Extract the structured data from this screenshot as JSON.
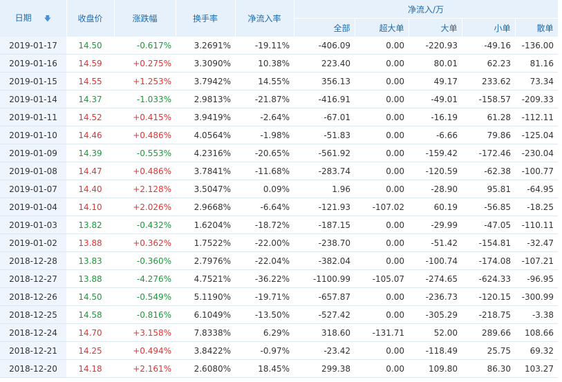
{
  "headers": {
    "date": "日期",
    "close": "收盘价",
    "change": "涨跌幅",
    "turnover": "换手率",
    "net_rate": "净流入率",
    "net_flow_group": "净流入/万",
    "all": "全部",
    "super": "超大单",
    "large": "大单",
    "small": "小单",
    "retail": "散单",
    "sort_icon": "sort-down-arrow-icon"
  },
  "colors": {
    "up": "#e53333",
    "down": "#1a9a3a",
    "header_bg": "#e7f1fb",
    "header_text": "#1c6bb0"
  },
  "rows": [
    {
      "date": "2019-01-17",
      "close": "14.50",
      "change": "-0.617%",
      "turnover": "3.2691%",
      "rate": "-19.11%",
      "all": "-406.09",
      "super": "0.00",
      "large": "-220.93",
      "small": "-49.16",
      "retail": "-136.00",
      "trend": "down"
    },
    {
      "date": "2019-01-16",
      "close": "14.59",
      "change": "+0.275%",
      "turnover": "3.3090%",
      "rate": "10.38%",
      "all": "223.40",
      "super": "0.00",
      "large": "80.01",
      "small": "62.23",
      "retail": "81.16",
      "trend": "up"
    },
    {
      "date": "2019-01-15",
      "close": "14.55",
      "change": "+1.253%",
      "turnover": "3.7942%",
      "rate": "14.55%",
      "all": "356.13",
      "super": "0.00",
      "large": "49.17",
      "small": "233.62",
      "retail": "73.34",
      "trend": "up"
    },
    {
      "date": "2019-01-14",
      "close": "14.37",
      "change": "-1.033%",
      "turnover": "2.9813%",
      "rate": "-21.87%",
      "all": "-416.91",
      "super": "0.00",
      "large": "-49.01",
      "small": "-158.57",
      "retail": "-209.33",
      "trend": "down"
    },
    {
      "date": "2019-01-11",
      "close": "14.52",
      "change": "+0.415%",
      "turnover": "3.9419%",
      "rate": "-2.64%",
      "all": "-67.01",
      "super": "0.00",
      "large": "-16.19",
      "small": "61.28",
      "retail": "-112.11",
      "trend": "up"
    },
    {
      "date": "2019-01-10",
      "close": "14.46",
      "change": "+0.486%",
      "turnover": "4.0564%",
      "rate": "-1.98%",
      "all": "-51.83",
      "super": "0.00",
      "large": "-6.66",
      "small": "79.86",
      "retail": "-125.04",
      "trend": "up"
    },
    {
      "date": "2019-01-09",
      "close": "14.39",
      "change": "-0.553%",
      "turnover": "4.2316%",
      "rate": "-20.65%",
      "all": "-561.92",
      "super": "0.00",
      "large": "-159.42",
      "small": "-172.46",
      "retail": "-230.04",
      "trend": "down"
    },
    {
      "date": "2019-01-08",
      "close": "14.47",
      "change": "+0.486%",
      "turnover": "3.7841%",
      "rate": "-11.68%",
      "all": "-283.74",
      "super": "0.00",
      "large": "-120.59",
      "small": "-62.38",
      "retail": "-100.77",
      "trend": "up"
    },
    {
      "date": "2019-01-07",
      "close": "14.40",
      "change": "+2.128%",
      "turnover": "3.5047%",
      "rate": "0.09%",
      "all": "1.96",
      "super": "0.00",
      "large": "-28.90",
      "small": "95.81",
      "retail": "-64.95",
      "trend": "up"
    },
    {
      "date": "2019-01-04",
      "close": "14.10",
      "change": "+2.026%",
      "turnover": "2.9668%",
      "rate": "-6.64%",
      "all": "-121.93",
      "super": "-107.02",
      "large": "60.19",
      "small": "-56.85",
      "retail": "-18.25",
      "trend": "up"
    },
    {
      "date": "2019-01-03",
      "close": "13.82",
      "change": "-0.432%",
      "turnover": "1.6204%",
      "rate": "-18.72%",
      "all": "-187.15",
      "super": "0.00",
      "large": "-29.99",
      "small": "-47.05",
      "retail": "-110.11",
      "trend": "down"
    },
    {
      "date": "2019-01-02",
      "close": "13.88",
      "change": "+0.362%",
      "turnover": "1.7522%",
      "rate": "-22.00%",
      "all": "-238.70",
      "super": "0.00",
      "large": "-51.42",
      "small": "-154.81",
      "retail": "-32.47",
      "trend": "up"
    },
    {
      "date": "2018-12-28",
      "close": "13.83",
      "change": "-0.360%",
      "turnover": "2.7976%",
      "rate": "-22.04%",
      "all": "-382.04",
      "super": "0.00",
      "large": "-100.74",
      "small": "-174.08",
      "retail": "-107.21",
      "trend": "down"
    },
    {
      "date": "2018-12-27",
      "close": "13.88",
      "change": "-4.276%",
      "turnover": "4.7521%",
      "rate": "-36.22%",
      "all": "-1100.99",
      "super": "-105.07",
      "large": "-274.65",
      "small": "-624.33",
      "retail": "-96.95",
      "trend": "down"
    },
    {
      "date": "2018-12-26",
      "close": "14.50",
      "change": "-0.549%",
      "turnover": "5.1190%",
      "rate": "-19.71%",
      "all": "-657.87",
      "super": "0.00",
      "large": "-236.73",
      "small": "-120.15",
      "retail": "-300.99",
      "trend": "down"
    },
    {
      "date": "2018-12-25",
      "close": "14.58",
      "change": "-0.816%",
      "turnover": "6.1049%",
      "rate": "-13.50%",
      "all": "-527.42",
      "super": "0.00",
      "large": "-305.29",
      "small": "-218.75",
      "retail": "-3.38",
      "trend": "down"
    },
    {
      "date": "2018-12-24",
      "close": "14.70",
      "change": "+3.158%",
      "turnover": "7.8338%",
      "rate": "6.29%",
      "all": "318.60",
      "super": "-131.71",
      "large": "52.00",
      "small": "289.66",
      "retail": "108.66",
      "trend": "up"
    },
    {
      "date": "2018-12-21",
      "close": "14.25",
      "change": "+0.494%",
      "turnover": "3.8422%",
      "rate": "-0.97%",
      "all": "-23.42",
      "super": "0.00",
      "large": "-118.49",
      "small": "25.75",
      "retail": "69.32",
      "trend": "up"
    },
    {
      "date": "2018-12-20",
      "close": "14.18",
      "change": "+2.161%",
      "turnover": "2.6080%",
      "rate": "18.45%",
      "all": "299.38",
      "super": "0.00",
      "large": "109.80",
      "small": "86.30",
      "retail": "103.27",
      "trend": "up"
    }
  ]
}
